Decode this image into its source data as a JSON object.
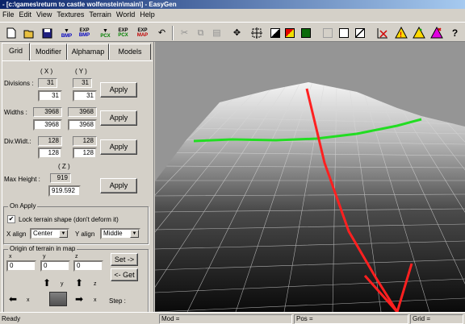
{
  "window": {
    "title": "- [c:\\games\\return to castle wolfenstein\\main\\] - EasyGen"
  },
  "menu": [
    "File",
    "Edit",
    "View",
    "Textures",
    "Terrain",
    "World",
    "Help"
  ],
  "toolbar": {
    "bmp_exp": "EXP",
    "bmp": "BMP",
    "pcx_exp": "EXP",
    "pcx": "PCX",
    "map_exp": "EXP",
    "map": "MAP",
    "help": "?"
  },
  "tabs": [
    "Grid",
    "Modifier",
    "Alphamap",
    "Models"
  ],
  "grid": {
    "x_header": "( X )",
    "y_header": "( Y )",
    "z_header": "( Z )",
    "divisions_label": "Divisions :",
    "divisions_x_current": "31",
    "divisions_y_current": "31",
    "divisions_x": "31",
    "divisions_y": "31",
    "widths_label": "Widths :",
    "widths_x_current": "3968",
    "widths_y_current": "3968",
    "widths_x": "3968",
    "widths_y": "3968",
    "divwidt_label": "Div.Widt.:",
    "divwidt_x_current": "128",
    "divwidt_y_current": "128",
    "divwidt_x": "128",
    "divwidt_y": "128",
    "maxheight_label": "Max Height :",
    "maxheight_current": "919",
    "maxheight": "919.592",
    "apply": "Apply"
  },
  "on_apply": {
    "title": "On Apply",
    "lock_label": "Lock terrain shape (don't deform it)",
    "lock_checked": true,
    "xalign_label": "X align",
    "xalign_value": "Center",
    "yalign_label": "Y align",
    "yalign_value": "Middle"
  },
  "origin": {
    "title": "Origin of terrain in map",
    "x_label": "x",
    "y_label": "y",
    "z_label": "z",
    "x_value": "0",
    "y_value": "0",
    "z_value": "0",
    "set_button": "Set ->",
    "get_button": "<- Get",
    "y_axis": "y",
    "z_axis": "z",
    "x_axis": "x",
    "x_axis2": "x",
    "step_label": "Step :"
  },
  "status": {
    "ready": "Ready",
    "mod": "Mod =",
    "pos": "Pos =",
    "grid": "Grid ="
  },
  "colors": {
    "titlebar": "#0a246a",
    "terrain_highlight": "#ffffff",
    "axis_red": "#ff2020",
    "axis_green": "#22dd22",
    "viewport_bg": "#959595"
  }
}
